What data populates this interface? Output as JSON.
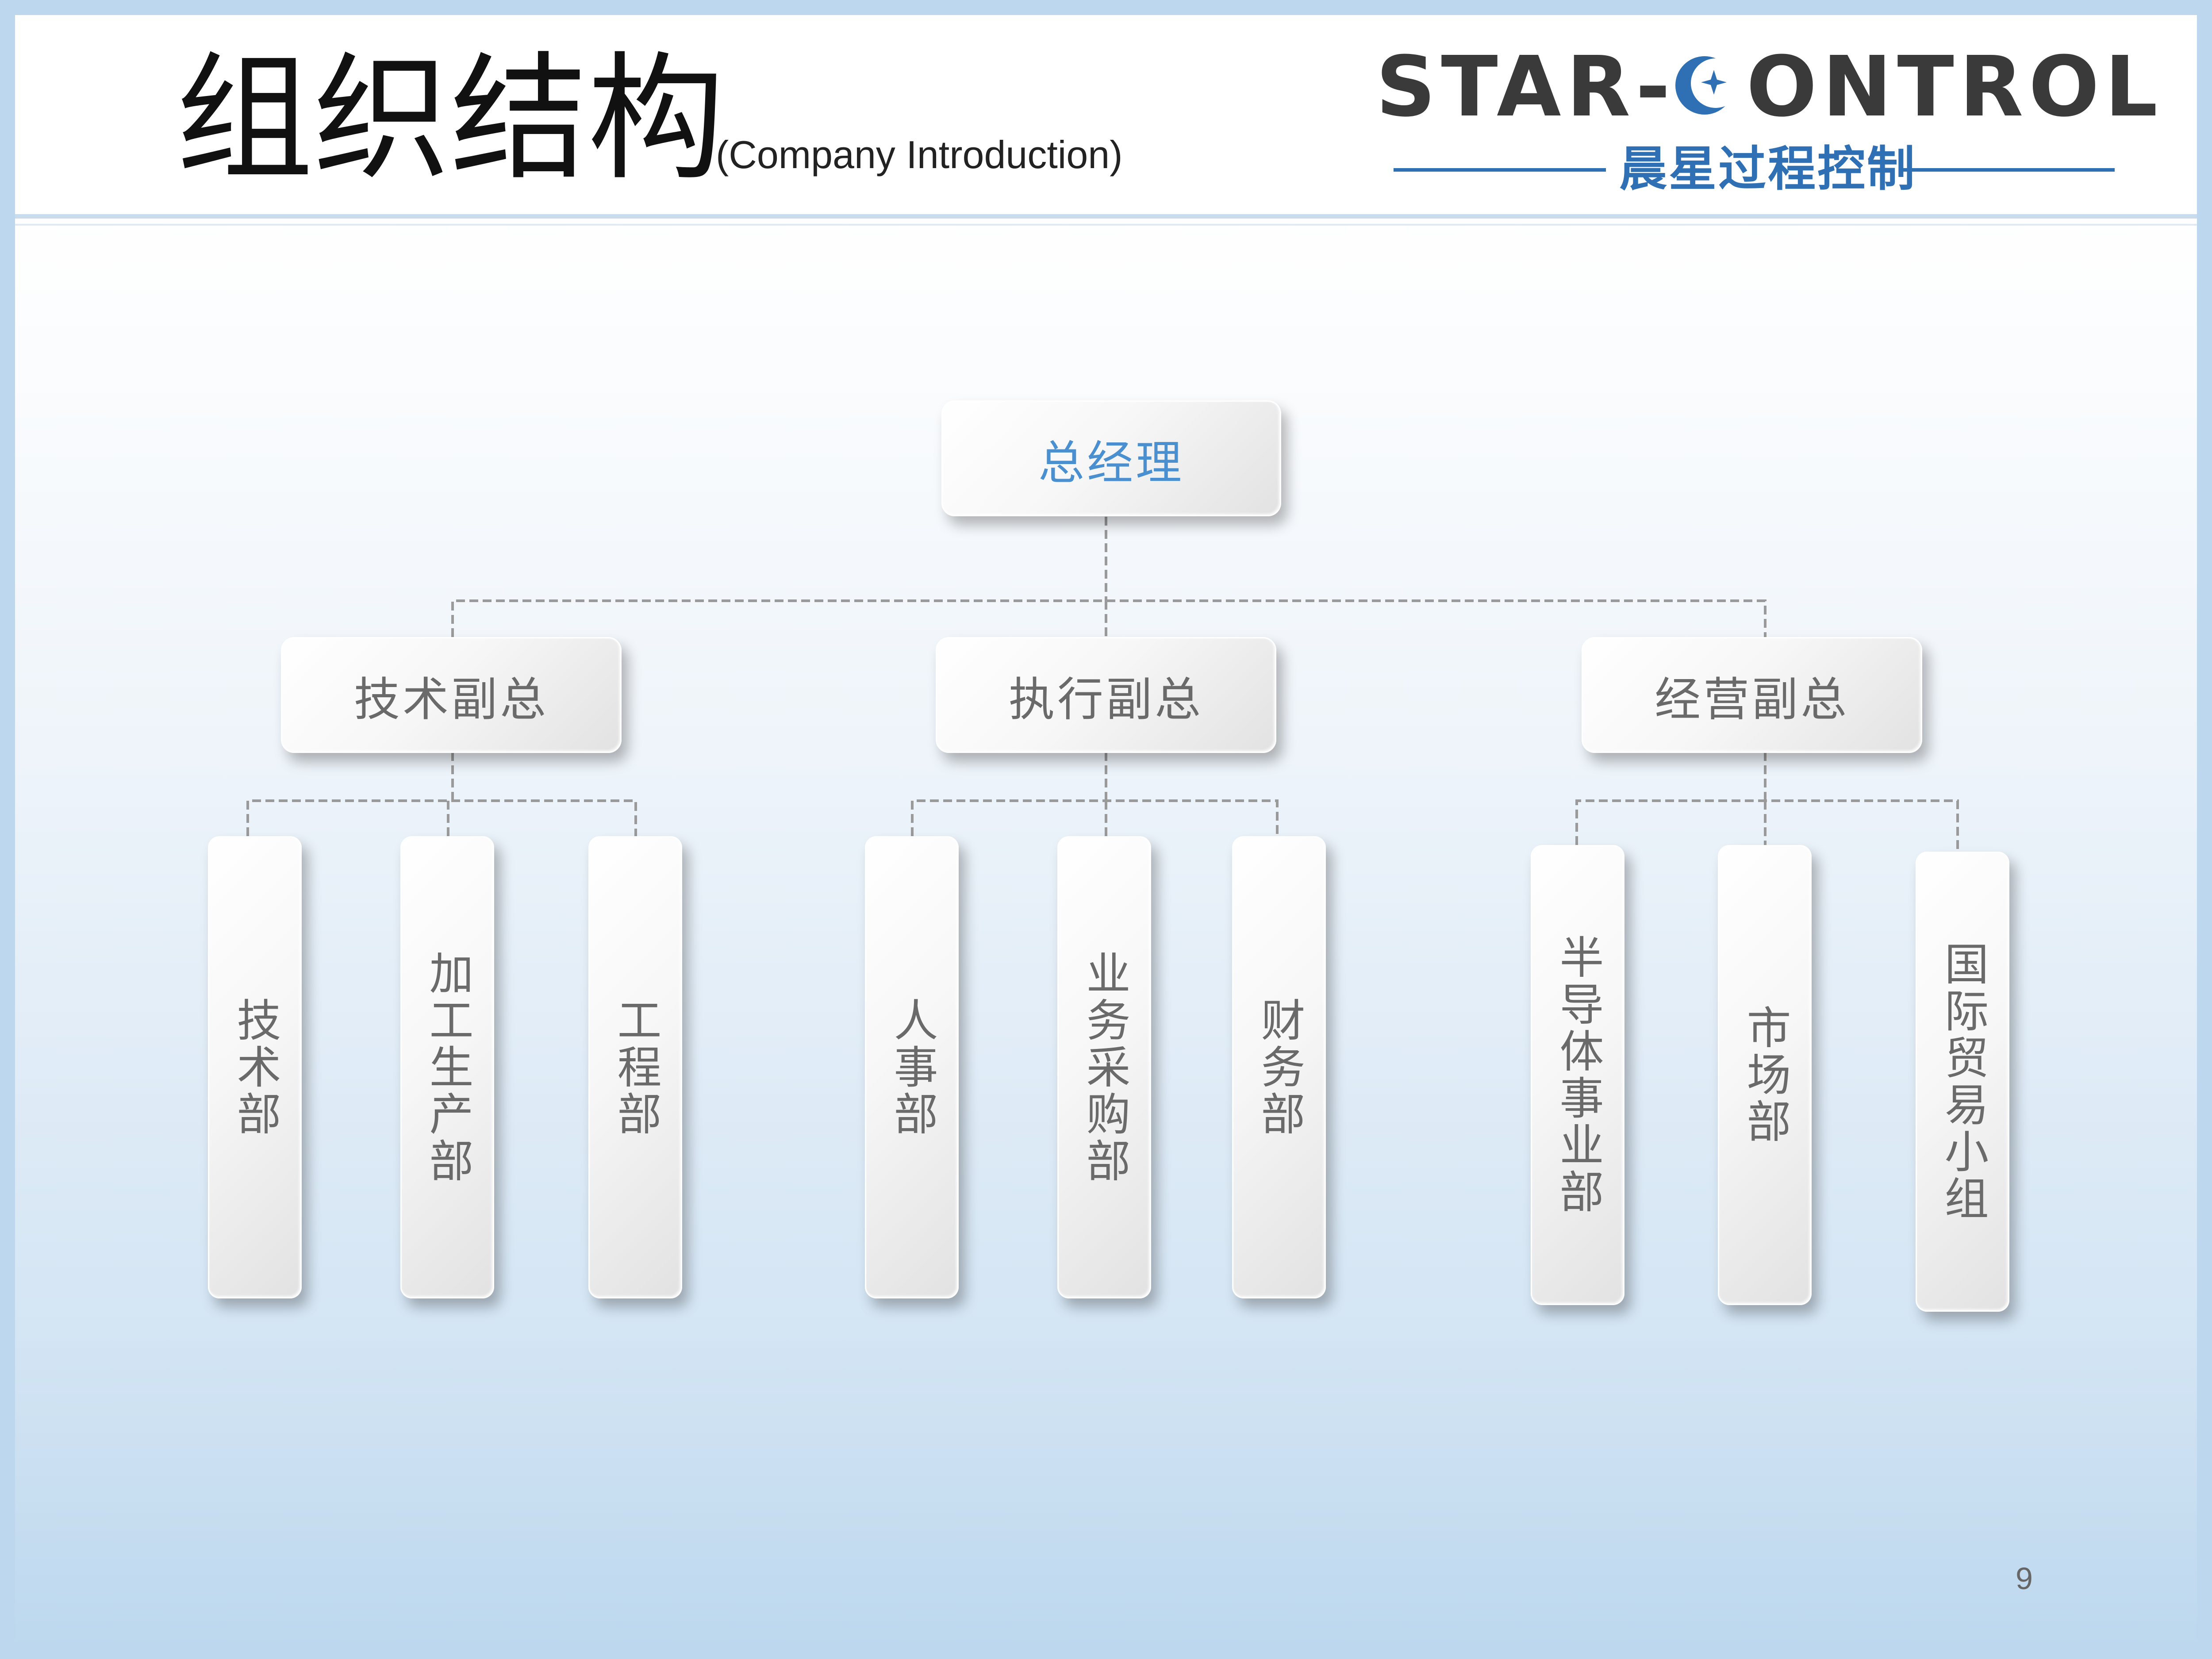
{
  "header": {
    "title": "组织结构",
    "subtitle": "(Company Introduction)"
  },
  "logo": {
    "text_left": "STAR-",
    "text_right": "ONTROL",
    "tagline": "晨星过程控制",
    "color_dark": "#3a3a3a",
    "color_accent": "#2f6fb3"
  },
  "org": {
    "root": "总经理",
    "vps": [
      {
        "label": "技术副总",
        "departments": [
          "技术部",
          "加工生产部",
          "工程部"
        ]
      },
      {
        "label": "执行副总",
        "departments": [
          "人事部",
          "业务采购部",
          "财务部"
        ]
      },
      {
        "label": "经营副总",
        "departments": [
          "半导体事业部",
          "市场部",
          "国际贸易小组"
        ]
      }
    ]
  },
  "colors": {
    "root_text": "#4a8fd0",
    "box_text": "#6a6a6a",
    "connector": "#9a9a9a",
    "frame": "#bcd7ee"
  },
  "page_number": "9"
}
